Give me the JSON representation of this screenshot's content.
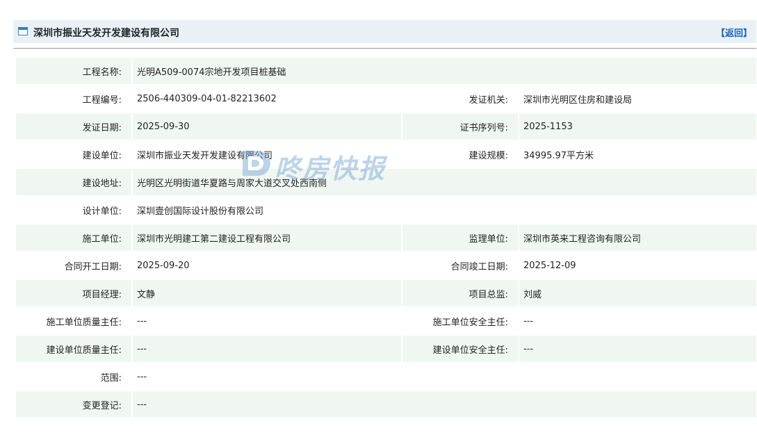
{
  "header": {
    "title": "深圳市振业天发开发建设有限公司",
    "back_label": "【返回】"
  },
  "watermark": {
    "text": "咚房快报",
    "color": "#6ea0cd"
  },
  "rows": [
    {
      "label1": "工程名称:",
      "value1": "光明A509-0074宗地开发项目桩基础",
      "label2": "",
      "value2": ""
    },
    {
      "label1": "工程编号:",
      "value1": "2506-440309-04-01-82213602",
      "label2": "发证机关:",
      "value2": "深圳市光明区住房和建设局"
    },
    {
      "label1": "发证日期:",
      "value1": "2025-09-30",
      "label2": "证书序列号:",
      "value2": "2025-1153"
    },
    {
      "label1": "建设单位:",
      "value1": "深圳市振业天发开发建设有限公司",
      "label2": "建设规模:",
      "value2": "34995.97平方米"
    },
    {
      "label1": "建设地址:",
      "value1": "光明区光明街道华夏路与周家大道交叉处西南侧",
      "label2": "",
      "value2": ""
    },
    {
      "label1": "设计单位:",
      "value1": "深圳壹创国际设计股份有限公司",
      "label2": "",
      "value2": ""
    },
    {
      "label1": "施工单位:",
      "value1": "深圳市光明建工第二建设工程有限公司",
      "label2": "监理单位:",
      "value2": "深圳市英来工程咨询有限公司"
    },
    {
      "label1": "合同开工日期:",
      "value1": "2025-09-20",
      "label2": "合同竣工日期:",
      "value2": "2025-12-09"
    },
    {
      "label1": "项目经理:",
      "value1": "文静",
      "label2": "项目总监:",
      "value2": "刘威"
    },
    {
      "label1": "施工单位质量主任:",
      "value1": "---",
      "label2": "施工单位安全主任:",
      "value2": "---"
    },
    {
      "label1": "建设单位质量主任:",
      "value1": "---",
      "label2": "建设单位安全主任:",
      "value2": "---"
    },
    {
      "label1": "范围:",
      "value1": "---",
      "label2": "",
      "value2": ""
    },
    {
      "label1": "变更登记:",
      "value1": "---",
      "label2": "",
      "value2": ""
    }
  ],
  "colors": {
    "header_bg": "#e9f1f7",
    "row_alt_bg": "#f0f7f3",
    "back_link": "#1b63b5",
    "icon_blue": "#2f7fc1"
  }
}
